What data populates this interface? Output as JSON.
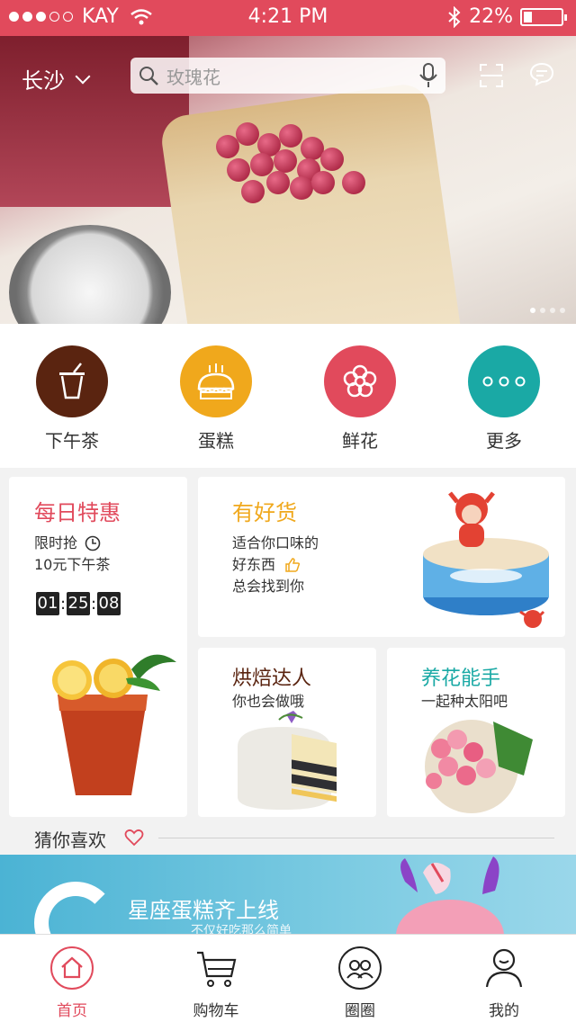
{
  "status_bar": {
    "carrier": "KAY",
    "time": "4:21 PM",
    "battery": "22%",
    "battery_level": 0.22
  },
  "header": {
    "city": "长沙",
    "search_placeholder": "玫瑰花"
  },
  "banner_pages": {
    "count": 4,
    "active": 0
  },
  "categories": [
    {
      "label": "下午茶",
      "color": "#5a2410",
      "icon": "tea-cup-icon"
    },
    {
      "label": "蛋糕",
      "color": "#f0a81c",
      "icon": "cake-icon"
    },
    {
      "label": "鲜花",
      "color": "#e14a5c",
      "icon": "flower-icon"
    },
    {
      "label": "更多",
      "color": "#1aa9a5",
      "icon": "more-icon"
    }
  ],
  "daily_deal": {
    "title": "每日特惠",
    "line1": "限时抢",
    "line2": "10元下午茶",
    "timer": [
      "01",
      "25",
      "08"
    ],
    "title_color": "#e14a5c"
  },
  "good_goods": {
    "title": "有好货",
    "line1": "适合你口味的",
    "line2": "好东西",
    "line3": "总会找到你",
    "title_color": "#f0a81c"
  },
  "baking": {
    "title": "烘焙达人",
    "subtitle": "你也会做哦",
    "title_color": "#5a2410"
  },
  "flowers": {
    "title": "养花能手",
    "subtitle": "一起种太阳吧",
    "title_color": "#1aa9a5"
  },
  "guess": {
    "label": "猜你喜欢"
  },
  "promo_banner": {
    "title": "星座蛋糕齐上线",
    "subtitle": "不仅好吃那么简单"
  },
  "tabbar": [
    {
      "label": "首页",
      "icon": "home-icon",
      "active": true
    },
    {
      "label": "购物车",
      "icon": "cart-icon",
      "active": false
    },
    {
      "label": "圈圈",
      "icon": "community-icon",
      "active": false
    },
    {
      "label": "我的",
      "icon": "profile-icon",
      "active": false
    }
  ],
  "colors": {
    "brand": "#e14a5c"
  }
}
